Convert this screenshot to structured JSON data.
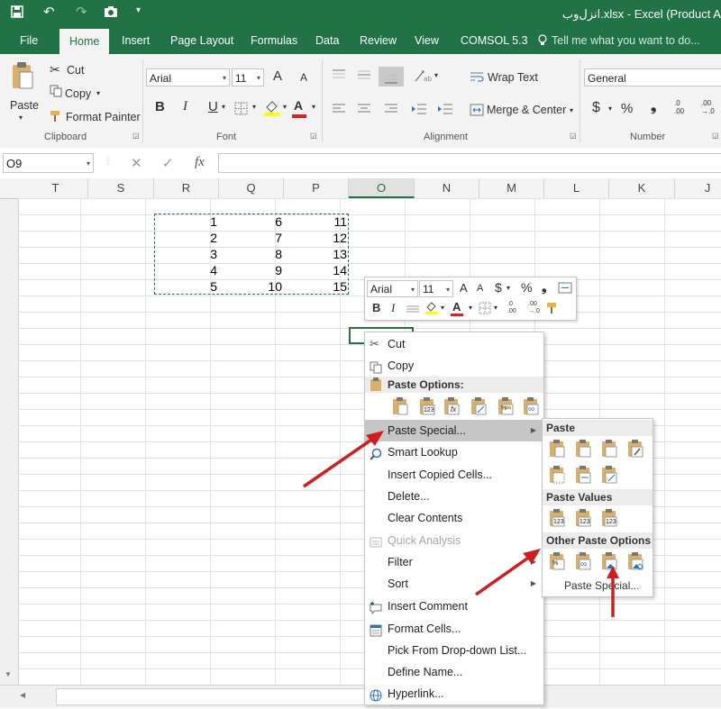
{
  "window": {
    "title": "انزل‌وب.xlsx - Excel (Product Act"
  },
  "tabs": [
    {
      "label": "File",
      "active": false
    },
    {
      "label": "Home",
      "active": true
    },
    {
      "label": "Insert",
      "active": false
    },
    {
      "label": "Page Layout",
      "active": false
    },
    {
      "label": "Formulas",
      "active": false
    },
    {
      "label": "Data",
      "active": false
    },
    {
      "label": "Review",
      "active": false
    },
    {
      "label": "View",
      "active": false
    },
    {
      "label": "COMSOL 5.3",
      "active": false
    }
  ],
  "tell_me": {
    "placeholder": "Tell me what you want to do..."
  },
  "ribbon": {
    "clipboard": {
      "paste": "Paste",
      "cut": "Cut",
      "copy": "Copy",
      "format_painter": "Format Painter",
      "group": "Clipboard"
    },
    "font": {
      "name": "Arial",
      "size": "11",
      "group": "Font",
      "bold": "B",
      "italic": "I",
      "underline": "U",
      "grow": "A",
      "shrink": "A"
    },
    "alignment": {
      "wrap": "Wrap Text",
      "merge": "Merge & Center",
      "group": "Alignment"
    },
    "number": {
      "format": "General",
      "currency": "$",
      "percent": "%",
      "comma": "❟",
      "inc_decimal_top": ".0",
      "inc_decimal_bottom": ".00",
      "dec_decimal_top": ".00",
      "dec_decimal_bottom": "→.0",
      "group": "Number"
    }
  },
  "formula_bar": {
    "name_box": "O9",
    "fx": "fx",
    "cancel": "✕",
    "enter": "✓"
  },
  "columns": [
    "T",
    "S",
    "R",
    "Q",
    "P",
    "O",
    "N",
    "M",
    "L",
    "K",
    "J"
  ],
  "selected_column": "O",
  "cells": [
    {
      "r": 1,
      "q": 6,
      "p": 11
    },
    {
      "r": 2,
      "q": 7,
      "p": 12
    },
    {
      "r": 3,
      "q": 8,
      "p": 13
    },
    {
      "r": 4,
      "q": 9,
      "p": 14
    },
    {
      "r": 5,
      "q": 10,
      "p": 15
    }
  ],
  "mini_toolbar": {
    "font": "Arial",
    "size": "11",
    "currency": "$",
    "percent": "%",
    "comma": "❟",
    "bold": "B",
    "italic": "I",
    "grow": "A",
    "shrink": "A",
    "font_color": "A",
    "dec_top": ".0",
    "dec_bottom": ".00",
    "inc_top": ".00",
    "inc_bottom": "→.0"
  },
  "context_menu": {
    "cut": "Cut",
    "copy": "Copy",
    "paste_options": "Paste Options:",
    "paste_special": "Paste Special...",
    "smart_lookup": "Smart Lookup",
    "insert_copied": "Insert Copied Cells...",
    "delete": "Delete...",
    "clear_contents": "Clear Contents",
    "quick_analysis": "Quick Analysis",
    "filter": "Filter",
    "sort": "Sort",
    "insert_comment": "Insert Comment",
    "format_cells": "Format Cells...",
    "pick_dropdown": "Pick From Drop-down List...",
    "define_name": "Define Name...",
    "hyperlink": "Hyperlink..."
  },
  "paste_icon_texts": {
    "values": "123",
    "formulas": "fx",
    "link": "∞",
    "percent": "%"
  },
  "submenu": {
    "paste": "Paste",
    "paste_values": "Paste Values",
    "other_paste_options": "Other Paste Options",
    "paste_special": "Paste Special..."
  },
  "colors": {
    "brand": "#217346",
    "annotation_arrow": "#cc1f1f",
    "highlight_yellow": "#ffff00",
    "font_red": "#e02020"
  }
}
